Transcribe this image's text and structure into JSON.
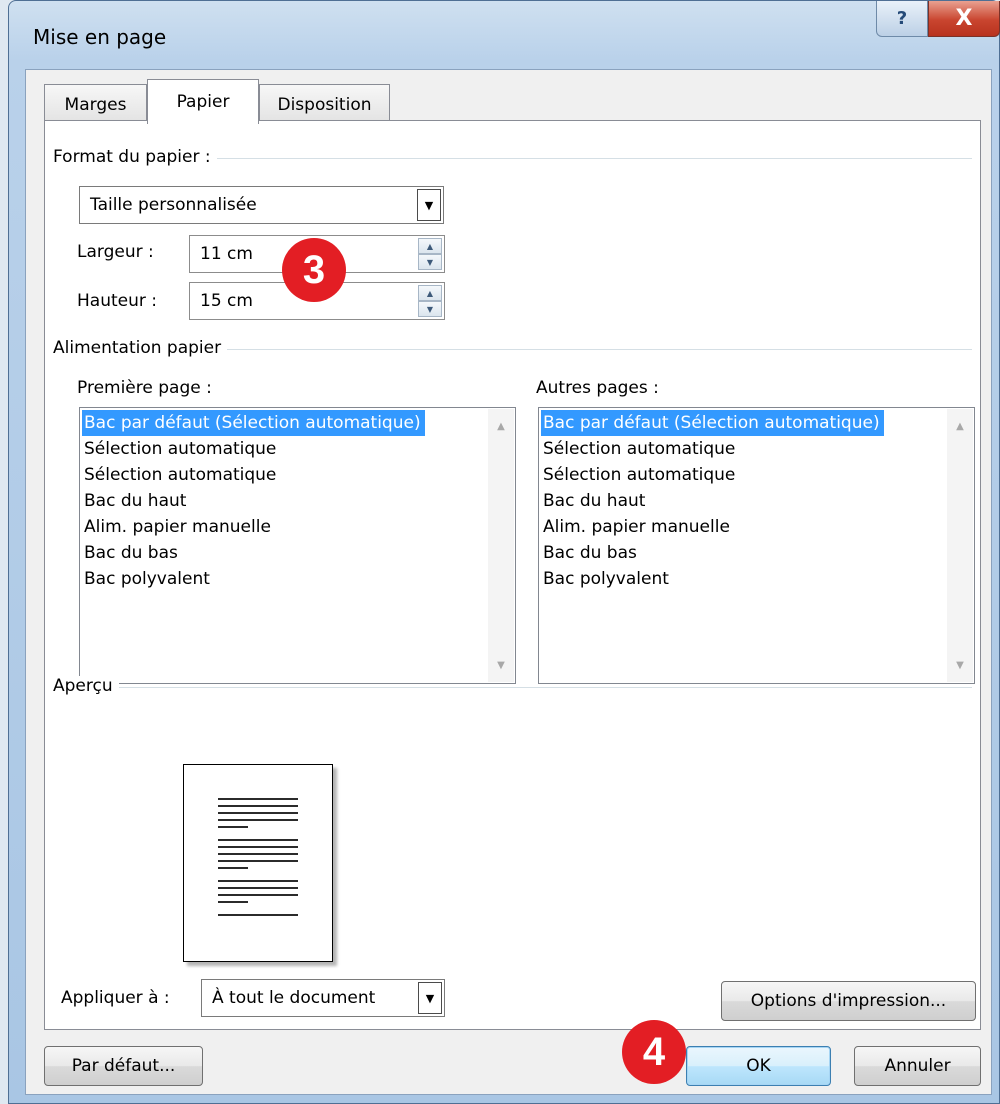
{
  "window": {
    "title": "Mise en page",
    "help_label": "?",
    "close_label": "X"
  },
  "tabs": [
    {
      "label": "Marges",
      "active": false
    },
    {
      "label": "Papier",
      "active": true
    },
    {
      "label": "Disposition",
      "active": false
    }
  ],
  "paper_format": {
    "group_label": "Format du papier :",
    "selected": "Taille personnalisée",
    "width_label": "Largeur :",
    "width_value": "11 cm",
    "height_label": "Hauteur :",
    "height_value": "15 cm"
  },
  "paper_source": {
    "group_label": "Alimentation papier",
    "first_page": {
      "label": "Première page :",
      "items": [
        "Bac par défaut (Sélection automatique)",
        "Sélection automatique",
        "Sélection automatique",
        "Bac du haut",
        "Alim. papier manuelle",
        "Bac du bas",
        "Bac polyvalent"
      ],
      "selected_index": 0
    },
    "other_pages": {
      "label": "Autres pages :",
      "items": [
        "Bac par défaut (Sélection automatique)",
        "Sélection automatique",
        "Sélection automatique",
        "Bac du haut",
        "Alim. papier manuelle",
        "Bac du bas",
        "Bac polyvalent"
      ],
      "selected_index": 0
    }
  },
  "preview": {
    "group_label": "Aperçu"
  },
  "apply_to": {
    "label": "Appliquer à :",
    "selected": "À tout le document"
  },
  "buttons": {
    "print_options": "Options d'impression...",
    "default": "Par défaut...",
    "ok": "OK",
    "cancel": "Annuler"
  },
  "annotations": {
    "step3": "3",
    "step4": "4"
  },
  "colors": {
    "selection": "#3399ff",
    "badge": "#e31e24"
  }
}
